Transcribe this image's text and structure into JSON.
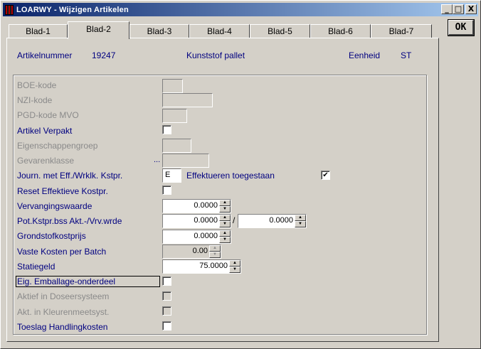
{
  "window": {
    "title": "LOARWY - Wijzigen Artikelen"
  },
  "caption": {
    "minimize": "_",
    "maximize": "□",
    "close": "X"
  },
  "ok_button": {
    "label": "OK"
  },
  "tabs": [
    {
      "label": "Blad-1",
      "active": false
    },
    {
      "label": "Blad-2",
      "active": true
    },
    {
      "label": "Blad-3",
      "active": false
    },
    {
      "label": "Blad-4",
      "active": false
    },
    {
      "label": "Blad-5",
      "active": false
    },
    {
      "label": "Blad-6",
      "active": false
    },
    {
      "label": "Blad-7",
      "active": false
    }
  ],
  "header": {
    "artnr_label": "Artikelnummer",
    "artnr_value": "19247",
    "description": "Kunststof pallet",
    "unit_label": "Eenheid",
    "unit_value": "ST"
  },
  "fields": {
    "boe": {
      "label": "BOE-kode"
    },
    "nzi": {
      "label": "NZI-kode"
    },
    "pgd": {
      "label": "PGD-kode MVO"
    },
    "verpakt": {
      "label": "Artikel Verpakt",
      "checked": false
    },
    "eigenschappen": {
      "label": "Eigenschappengroep"
    },
    "gevaren": {
      "label": "Gevarenklasse",
      "ellipsis": "..."
    },
    "journ": {
      "label": "Journ. met Eff./Wrklk. Kstpr.",
      "code": "E",
      "effect_label": "Effektueren toegestaan",
      "effect_checked": true
    },
    "reset": {
      "label": "Reset Effektieve Kostpr.",
      "checked": false
    },
    "vervanging": {
      "label": "Vervangingswaarde",
      "value": "0.0000"
    },
    "potkst": {
      "label": "Pot.Kstpr.bss Akt.-/Vrv.wrde",
      "value1": "0.0000",
      "separator": "/",
      "value2": "0.0000"
    },
    "grondstof": {
      "label": "Grondstofkostprijs",
      "value": "0.0000"
    },
    "vaste": {
      "label": "Vaste Kosten per Batch",
      "value": "0.00"
    },
    "statiegeld": {
      "label": "Statiegeld",
      "value": "75.0000"
    },
    "emballage": {
      "label": "Eig. Emballage-onderdeel",
      "checked": false
    },
    "doseer": {
      "label": "Aktief in Doseersysteem",
      "checked": false
    },
    "kleuren": {
      "label": "Akt. in Kleurenmeetsyst.",
      "checked": false
    },
    "toeslag": {
      "label": "Toeslag Handlingkosten",
      "checked": false
    }
  },
  "icons": {
    "spin_up": "▲",
    "spin_down": "▼",
    "check": "✔"
  }
}
